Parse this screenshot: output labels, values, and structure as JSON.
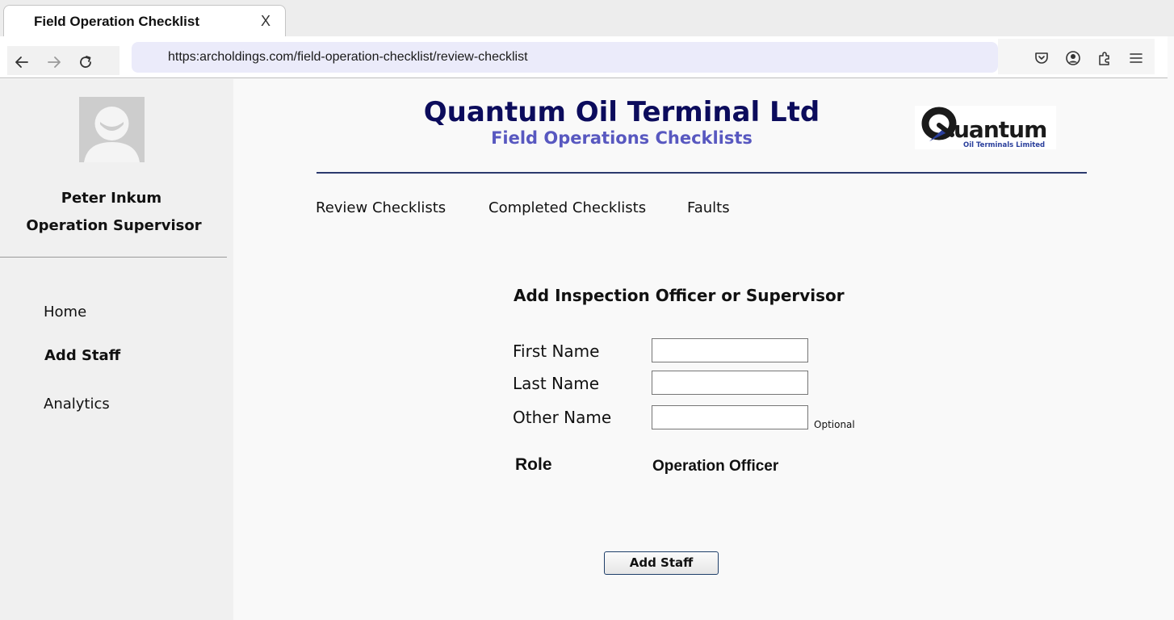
{
  "browser": {
    "tab_title": "Field Operation Checklist",
    "tab_close": "X",
    "url": "https:archoldings.com/field-operation-checklist/review-checklist"
  },
  "sidebar": {
    "user_name": "Peter Inkum",
    "user_role": "Operation Supervisor",
    "items": [
      {
        "label": "Home",
        "active": false
      },
      {
        "label": "Add Staff",
        "active": true
      },
      {
        "label": "Analytics",
        "active": false
      }
    ]
  },
  "header": {
    "company": "Quantum Oil Terminal Ltd",
    "subtitle": "Field Operations Checklists",
    "logo_word": "uantum",
    "logo_tagline": "Oil Terminals Limited"
  },
  "topnav": [
    "Review Checklists",
    "Completed Checklists",
    "Faults"
  ],
  "form": {
    "title": "Add Inspection Officer or Supervisor",
    "fields": [
      {
        "label": "First Name",
        "value": "",
        "note": ""
      },
      {
        "label": "Last Name",
        "value": "",
        "note": ""
      },
      {
        "label": "Other Name",
        "value": "",
        "note": "Optional"
      }
    ],
    "role_label": "Role",
    "role_value": "Operation Officer",
    "submit_label": "Add Staff"
  },
  "colors": {
    "company_title": "#0c0c5c",
    "subtitle": "#5858c0",
    "header_rule": "#2c3a6e",
    "url_bar": "#ebebfa",
    "sidebar_bg": "#f0f0f0"
  }
}
